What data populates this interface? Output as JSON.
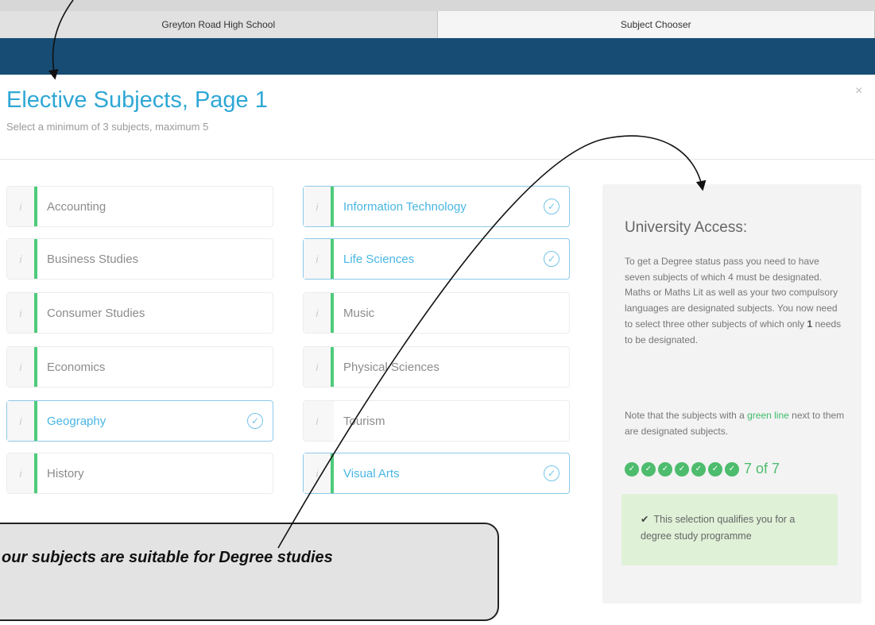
{
  "browser_tabs": [
    "Greyton Road High School",
    "Subject Chooser"
  ],
  "modal": {
    "title": "Elective Subjects, Page 1",
    "subtitle": "Select a minimum of 3 subjects, maximum 5",
    "close_icon": "×"
  },
  "subjects": {
    "left": [
      {
        "label": "Accounting",
        "selected": false,
        "designated": true
      },
      {
        "label": "Business Studies",
        "selected": false,
        "designated": true
      },
      {
        "label": "Consumer Studies",
        "selected": false,
        "designated": true
      },
      {
        "label": "Economics",
        "selected": false,
        "designated": true
      },
      {
        "label": "Geography",
        "selected": true,
        "designated": true
      },
      {
        "label": "History",
        "selected": false,
        "designated": true
      }
    ],
    "right": [
      {
        "label": "Information Technology",
        "selected": true,
        "designated": true
      },
      {
        "label": "Life Sciences",
        "selected": true,
        "designated": true
      },
      {
        "label": "Music",
        "selected": false,
        "designated": true
      },
      {
        "label": "Physical Sciences",
        "selected": false,
        "designated": true
      },
      {
        "label": "Tourism",
        "selected": false,
        "designated": false
      },
      {
        "label": "Visual Arts",
        "selected": true,
        "designated": true
      }
    ],
    "info_icon": "i"
  },
  "panel": {
    "title": "University Access:",
    "text_before_bold": "To get a Degree status pass you need to have seven subjects of which 4 must be designated. Maths or Maths Lit as well as your two compulsory languages are designated subjects. You now need to select three other subjects of which only ",
    "bold": "1",
    "text_after_bold": " needs to be designated.",
    "note_before": "Note that the subjects with a ",
    "note_green": "green line",
    "note_after": " next to them are designated subjects.",
    "progress_text": "7 of 7",
    "progress_count": 7,
    "progress_total": 7,
    "qualify_text": "This selection qualifies you for a degree study programme"
  },
  "callout_text": "our subjects are suitable for Degree studies",
  "colors": {
    "banner": "#174d74",
    "title": "#2fa7d6",
    "designated_line": "#4dcb7a",
    "progress_green": "#4dbc6d",
    "qualify_bg": "#dff1d7"
  }
}
